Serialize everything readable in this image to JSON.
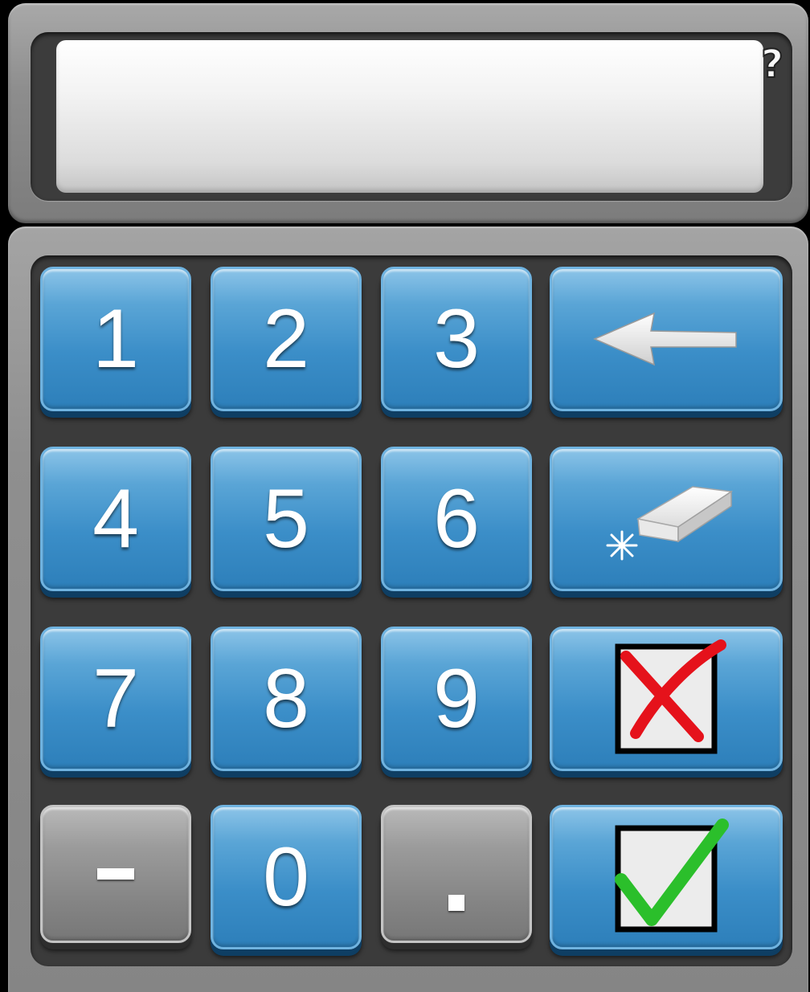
{
  "display": {
    "value": "",
    "help_label": "?"
  },
  "keys": {
    "k1": "1",
    "k2": "2",
    "k3": "3",
    "k4": "4",
    "k5": "5",
    "k6": "6",
    "k7": "7",
    "k8": "8",
    "k9": "9",
    "k0": "0"
  },
  "icons": {
    "backspace": "arrow-left-icon",
    "clear": "eraser-icon",
    "cancel": "red-x-checkbox-icon",
    "confirm": "green-check-checkbox-icon",
    "minus": "minus-icon",
    "decimal": "dot-icon"
  },
  "colors": {
    "key_blue": "#3b8ec8",
    "key_gray": "#8f8f8f",
    "cancel_red": "#e5121b",
    "confirm_green": "#2bbf2b"
  }
}
